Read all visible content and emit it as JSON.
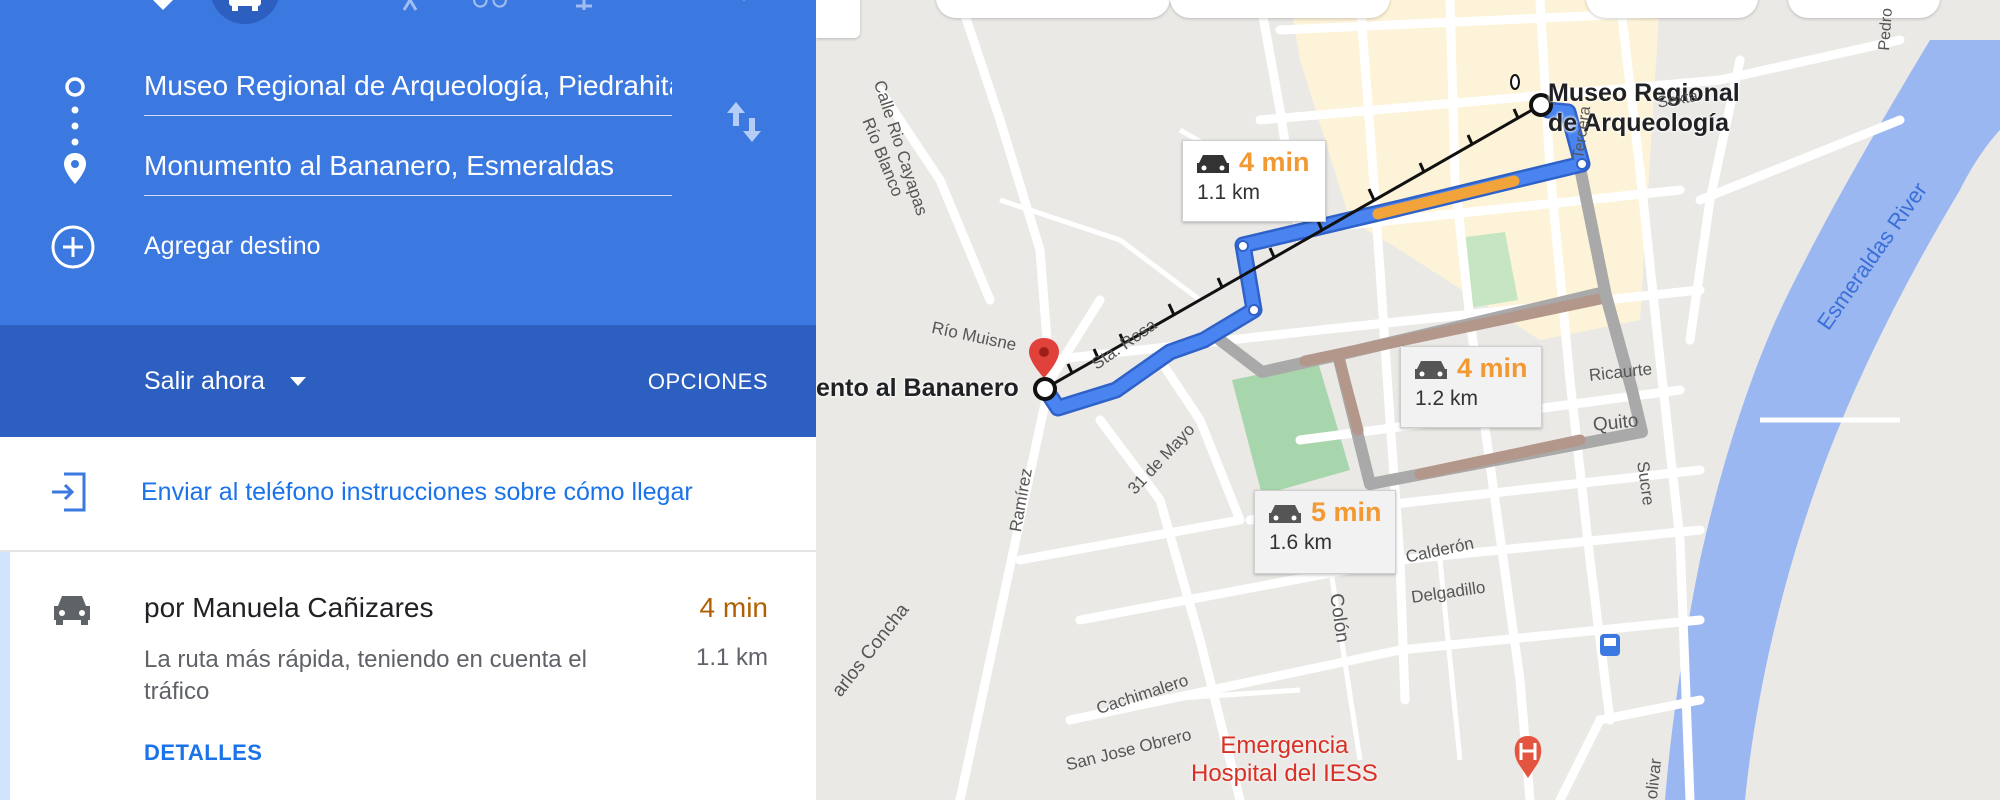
{
  "directions": {
    "origin_value": "Museo Regional de Arqueología, Piedrahita",
    "destination_value": "Monumento al Bananero, Esmeraldas",
    "add_destination_label": "Agregar destino",
    "depart_label": "Salir ahora",
    "options_label": "OPCIONES",
    "send_to_phone_label": "Enviar al teléfono instrucciones sobre cómo llegar",
    "route": {
      "title": "por Manuela Cañizares",
      "time": "4 min",
      "distance": "1.1 km",
      "description": "La ruta más rápida, teniendo en cuenta el tráfico",
      "details_label": "DETALLES"
    }
  },
  "map": {
    "origin_label_line1": "Museo Regional",
    "origin_label_line2": "de Arqueología",
    "destination_label": "ento al Bananero",
    "poi_label_line1": "Emergencia",
    "poi_label_line2": "Hospital del IESS",
    "river_label": "Esmeraldas River",
    "route_tips": [
      {
        "time": "4 min",
        "distance": "1.1 km"
      },
      {
        "time": "4 min",
        "distance": "1.2 km"
      },
      {
        "time": "5 min",
        "distance": "1.6 km"
      }
    ],
    "streets": {
      "rio_cayapas": "Calle Rio Cayapas",
      "rio_blanco": "Río Blanco",
      "rio_muisne": "Río Muisne",
      "sta_rosa": "Sta. Rosa",
      "mayo": "31 de Mayo",
      "ramirez": "Ramírez",
      "carlos_concha": "arlos Concha",
      "cachimalero": "Cachimalero",
      "san_jose": "San Jose Obrero",
      "calderon": "Calderón",
      "delgadillo": "Delgadillo",
      "colon": "Colón",
      "ricaurte": "Ricaurte",
      "quito": "Quito",
      "sucre": "Sucre",
      "sexta": "Sexta",
      "tercera": "Tercera",
      "olivar": "olivar",
      "pedro": "Pedro"
    },
    "colors": {
      "route_primary": "#4a84f0",
      "route_alt": "#a9a9a9",
      "traffic_orange": "#f2a33a",
      "traffic_brown": "#b3978a",
      "river": "#9ab7f1",
      "park": "#a8d6ac",
      "pin": "#e0413b",
      "hospital": "#e3553f"
    }
  }
}
